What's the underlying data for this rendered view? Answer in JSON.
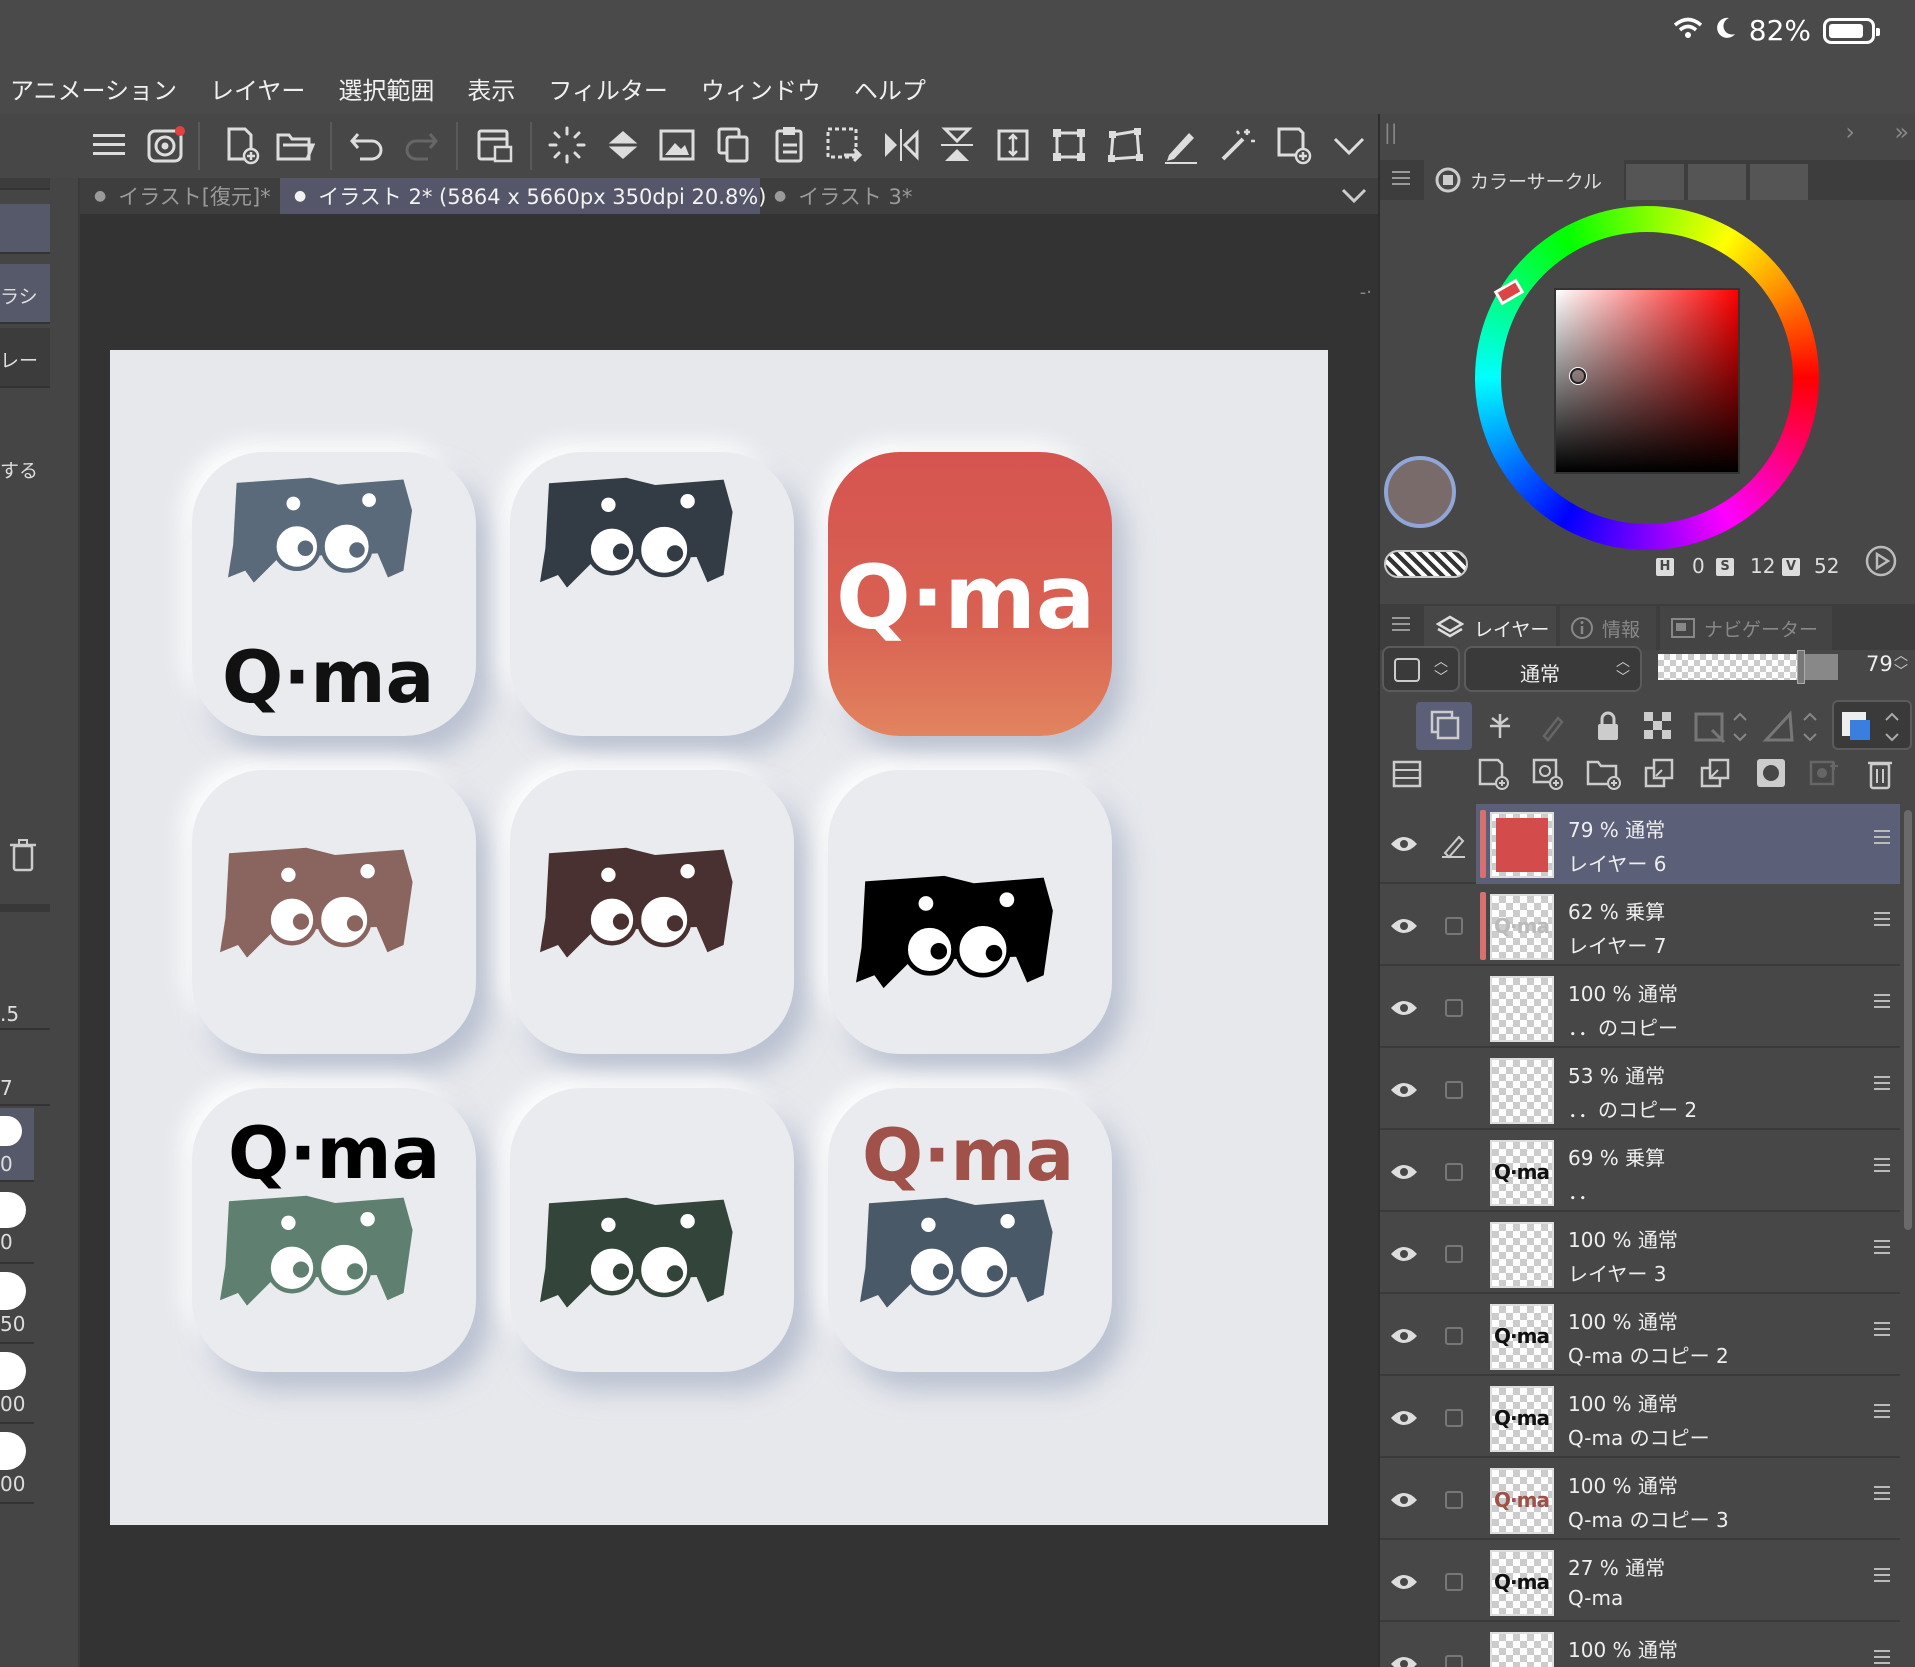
{
  "status": {
    "battery_percent": "82%"
  },
  "menu": [
    "アニメーション",
    "レイヤー",
    "選択範囲",
    "表示",
    "フィルター",
    "ウィンドウ",
    "ヘルプ"
  ],
  "tabs": [
    {
      "label": "イラスト[復元]*"
    },
    {
      "label": "イラスト 2* (5864 x 5660px 350dpi 20.8%)"
    },
    {
      "label": "イラスト 3*"
    }
  ],
  "left_panel": {
    "labels": [
      "ラシ",
      "レー",
      "する"
    ],
    "sizes": [
      ".5",
      "7",
      "0",
      "0",
      "50",
      "00",
      "00"
    ]
  },
  "canvas": {
    "logo_text": "Q·ma"
  },
  "color_panel": {
    "tabs": [
      "カラーサークル"
    ],
    "h_label": "H",
    "s_label": "S",
    "v_label": "V",
    "h": "0",
    "s": "12",
    "v": "52",
    "main_color": "#7a6b6b"
  },
  "layer_panel": {
    "tabs": [
      "レイヤー",
      "情報",
      "ナビゲーター"
    ],
    "blend_mode": "通常",
    "opacity": "79",
    "layers": [
      {
        "line1": "79 % 通常",
        "line2": "レイヤー 6",
        "selected": true
      },
      {
        "line1": "62 % 乗算",
        "line2": "レイヤー 7"
      },
      {
        "line1": "100 % 通常",
        "line2": "．．のコピー"
      },
      {
        "line1": "53 % 通常",
        "line2": "．．のコピー 2"
      },
      {
        "line1": "69 % 乗算",
        "line2": "．．"
      },
      {
        "line1": "100 % 通常",
        "line2": "レイヤー 3"
      },
      {
        "line1": "100 % 通常",
        "line2": "Q-ma のコピー 2"
      },
      {
        "line1": "100 % 通常",
        "line2": "Q-ma のコピー"
      },
      {
        "line1": "100 % 通常",
        "line2": "Q-ma のコピー 3"
      },
      {
        "line1": "27 % 通常",
        "line2": "Q-ma"
      },
      {
        "line1": "100 % 通常",
        "line2": ""
      }
    ]
  }
}
